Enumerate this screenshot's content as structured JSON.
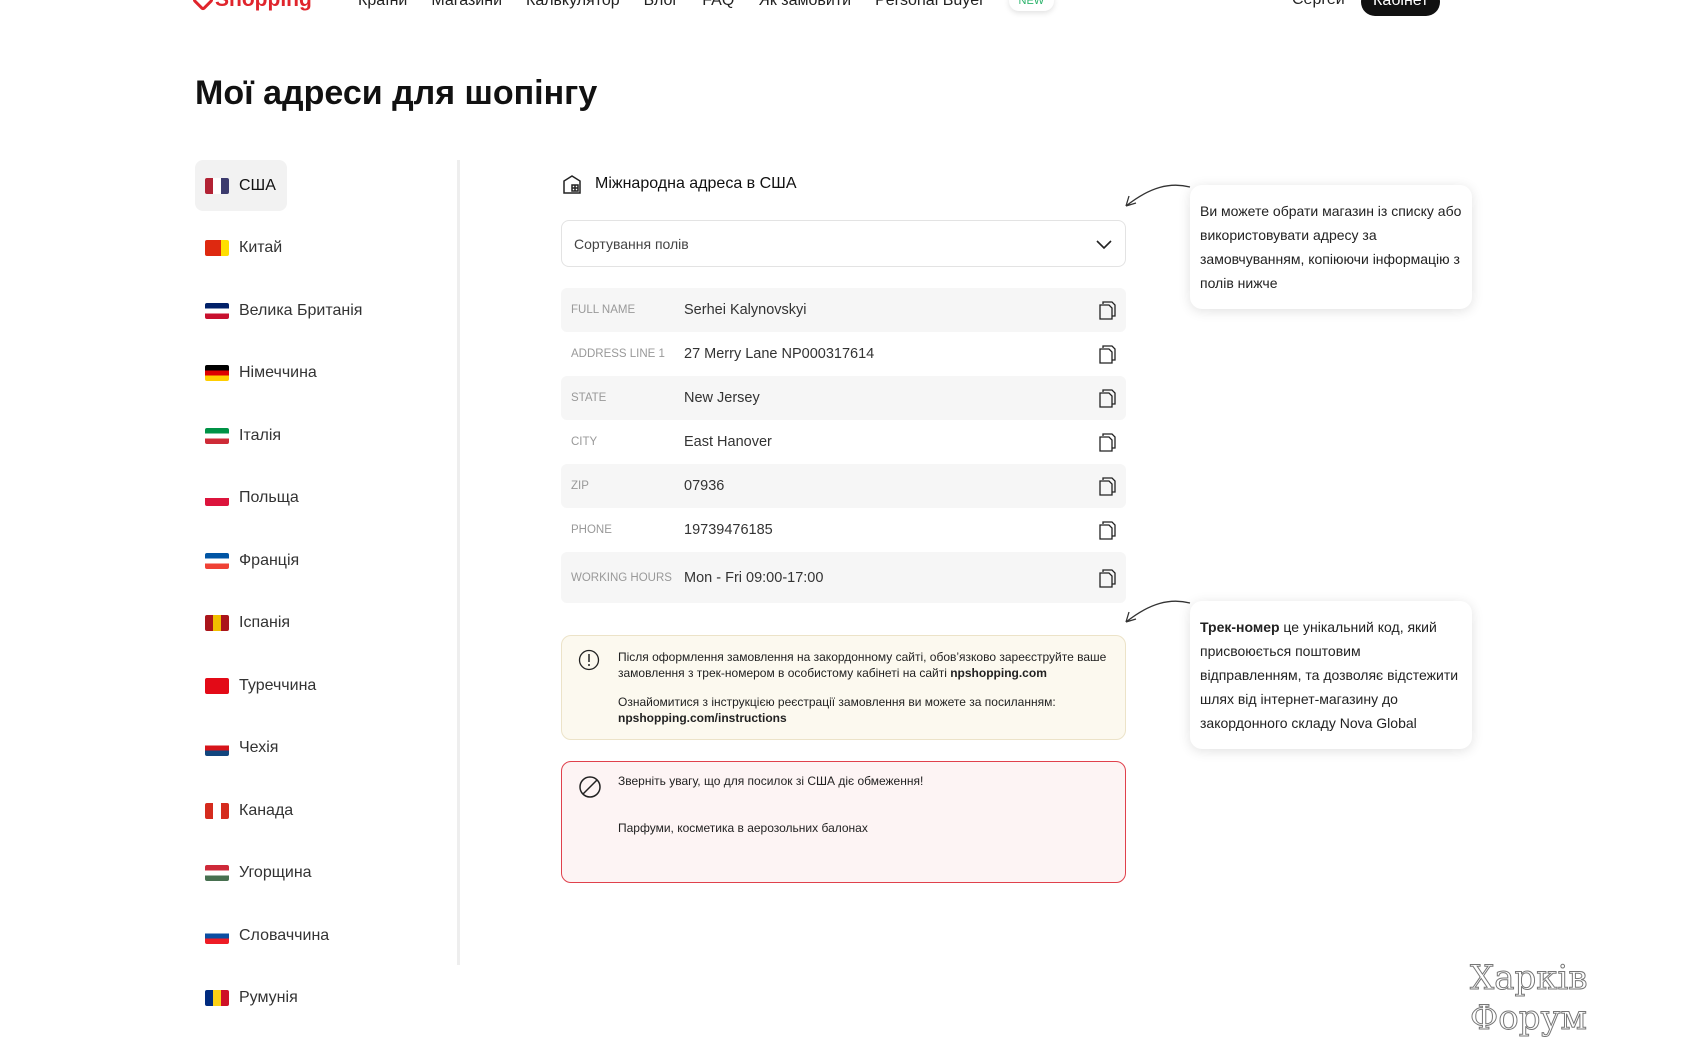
{
  "nav": {
    "logo": "Shopping",
    "items": [
      "Країни",
      "Магазини",
      "Калькулятор",
      "Блог",
      "FAQ",
      "Як замовити",
      "Personal Buyer"
    ],
    "badge": "NEW",
    "user": "Сергей",
    "cabinet": "Кабінет"
  },
  "title": "Мої адреси для шопінгу",
  "sidebar": [
    {
      "label": "США",
      "flag": [
        "#b22234",
        "#fff",
        "#3c3b6e"
      ]
    },
    {
      "label": "Китай",
      "flag": [
        "#de2910",
        "#de2910",
        "#ffde00"
      ]
    },
    {
      "label": "Велика Британія",
      "flag": [
        "#012169",
        "#fff",
        "#c8102e"
      ]
    },
    {
      "label": "Німеччина",
      "flag": [
        "#000",
        "#dd0000",
        "#ffce00"
      ]
    },
    {
      "label": "Італія",
      "flag": [
        "#009246",
        "#fff",
        "#ce2b37"
      ]
    },
    {
      "label": "Польща",
      "flag": [
        "#fff",
        "#fff",
        "#dc143c"
      ]
    },
    {
      "label": "Франція",
      "flag": [
        "#0055a4",
        "#fff",
        "#ef4135"
      ]
    },
    {
      "label": "Іспанія",
      "flag": [
        "#aa151b",
        "#f1bf00",
        "#aa151b"
      ]
    },
    {
      "label": "Туреччина",
      "flag": [
        "#e30a17",
        "#e30a17",
        "#e30a17"
      ]
    },
    {
      "label": "Чехія",
      "flag": [
        "#fff",
        "#d7141a",
        "#11457e"
      ]
    },
    {
      "label": "Канада",
      "flag": [
        "#d52b1e",
        "#fff",
        "#d52b1e"
      ]
    },
    {
      "label": "Угорщина",
      "flag": [
        "#ce2939",
        "#fff",
        "#477050"
      ]
    },
    {
      "label": "Словаччина",
      "flag": [
        "#fff",
        "#0b4ea2",
        "#ee1c25"
      ]
    },
    {
      "label": "Румунія",
      "flag": [
        "#002b7f",
        "#fcd116",
        "#ce1126"
      ]
    }
  ],
  "panel": {
    "heading": "Міжнародна адреса в США",
    "sort_label": "Сортування полів",
    "rows": [
      {
        "label": "Full name",
        "value": "Serhei Kalynovskyi"
      },
      {
        "label": "Address line 1",
        "value": "27 Merry Lane NP000317614"
      },
      {
        "label": "State",
        "value": "New Jersey"
      },
      {
        "label": "City",
        "value": "East Hanover"
      },
      {
        "label": "Zip",
        "value": "07936"
      },
      {
        "label": "Phone",
        "value": "19739476185"
      },
      {
        "label": "Working hours",
        "value": "Mon - Fri 09:00-17:00"
      }
    ],
    "info": {
      "p1": "Після оформлення замовлення на закордонному сайті, обов’язково зареєструйте ваше замовлення з трек-номером в особистому кабінеті на сайті ",
      "p1_link": "npshopping.com",
      "p2": "Ознайомитися з інструкцією реєстрації замовлення ви можете за посиланням:",
      "p2_link": "npshopping.com/instructions"
    },
    "warning": {
      "title": "Зверніть увагу, що для посилок зі США діє обмеження!",
      "items": "Парфуми, косметика в аерозольних балонах"
    }
  },
  "tips": {
    "t1": "Ви можете обрати магазин із списку або використовувати адресу за замовчуванням, копіюючи інформацію з полів нижче",
    "t2_bold": "Трек-номер",
    "t2": " це унікальний код, який присвоюється поштовим відправленням, та дозволяє відстежити шлях від інтернет-магазину до закордонного складу Nova Global"
  },
  "watermark": "Харків Форум"
}
